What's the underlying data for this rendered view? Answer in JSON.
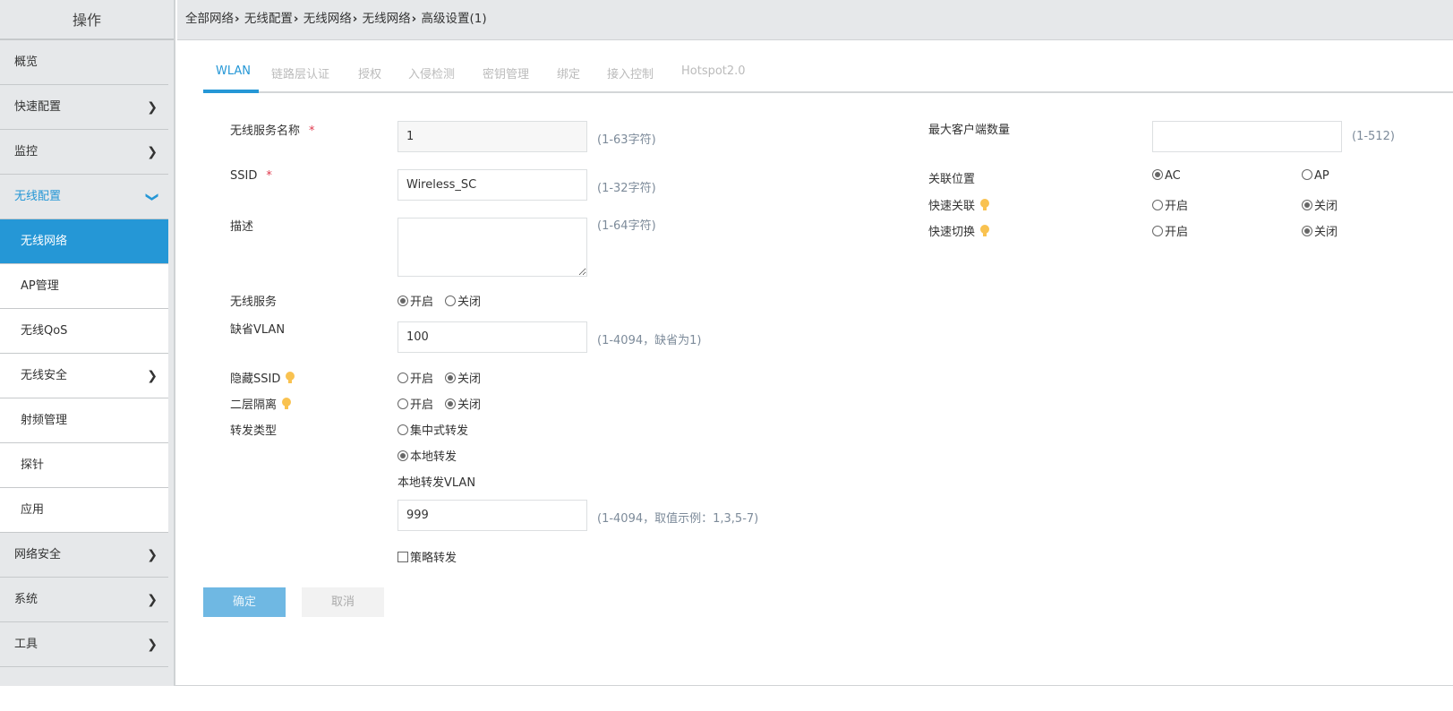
{
  "sidebar": {
    "title": "操作",
    "items": [
      {
        "label": "概览"
      },
      {
        "label": "快速配置"
      },
      {
        "label": "监控"
      },
      {
        "label": "无线配置"
      },
      {
        "label": "无线网络"
      },
      {
        "label": "AP管理"
      },
      {
        "label": "无线QoS"
      },
      {
        "label": "无线安全"
      },
      {
        "label": "射频管理"
      },
      {
        "label": "探针"
      },
      {
        "label": "应用"
      },
      {
        "label": "网络安全"
      },
      {
        "label": "系统"
      },
      {
        "label": "工具"
      }
    ]
  },
  "breadcrumb": [
    "全部网络",
    "无线配置",
    "无线网络",
    "无线网络",
    "高级设置(1)"
  ],
  "tabs": [
    "WLAN",
    "链路层认证",
    "授权",
    "入侵检测",
    "密钥管理",
    "绑定",
    "接入控制",
    "Hotspot2.0"
  ],
  "form": {
    "service_name": {
      "label": "无线服务名称",
      "required": "*",
      "value": "1",
      "hint": "(1-63字符)"
    },
    "ssid": {
      "label": "SSID",
      "required": "*",
      "value": "Wireless_SC",
      "hint": "(1-32字符)"
    },
    "description": {
      "label": "描述",
      "value": "",
      "hint": "(1-64字符)"
    },
    "wireless_service": {
      "label": "无线服务",
      "on": "开启",
      "off": "关闭",
      "selected": "on"
    },
    "default_vlan": {
      "label": "缺省VLAN",
      "value": "100",
      "hint": "(1-4094，缺省为1)"
    },
    "hide_ssid": {
      "label": "隐藏SSID",
      "on": "开启",
      "off": "关闭",
      "selected": "off"
    },
    "l2_isolation": {
      "label": "二层隔离",
      "on": "开启",
      "off": "关闭",
      "selected": "off"
    },
    "forward_type": {
      "label": "转发类型",
      "central": "集中式转发",
      "local": "本地转发",
      "selected": "local"
    },
    "local_vlan": {
      "label": "本地转发VLAN",
      "value": "999",
      "hint": "(1-4094，取值示例：1,3,5-7)"
    },
    "policy_forward": {
      "label": "策略转发",
      "checked": false
    },
    "max_clients": {
      "label": "最大客户端数量",
      "value": "",
      "hint": "(1-512)"
    },
    "assoc_location": {
      "label": "关联位置",
      "ac": "AC",
      "ap": "AP",
      "selected": "AC"
    },
    "fast_assoc": {
      "label": "快速关联",
      "on": "开启",
      "off": "关闭",
      "selected": "off"
    },
    "fast_roam": {
      "label": "快速切换",
      "on": "开启",
      "off": "关闭",
      "selected": "off"
    }
  },
  "buttons": {
    "ok": "确定",
    "cancel": "取消"
  },
  "colors": {
    "accent": "#2597d6",
    "bulb": "#f9c250"
  }
}
